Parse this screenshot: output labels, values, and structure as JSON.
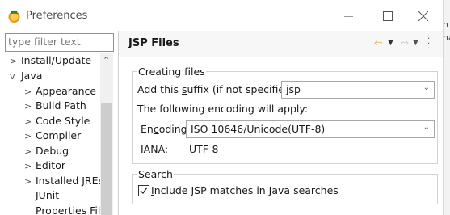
{
  "window": {
    "title": "Preferences"
  },
  "filter": {
    "placeholder": "type filter text"
  },
  "tree": {
    "items": [
      {
        "label": "Install/Update",
        "arrow": ">"
      },
      {
        "label": "Java",
        "arrow": "v"
      },
      {
        "label": "Appearance",
        "arrow": ">"
      },
      {
        "label": "Build Path",
        "arrow": ">"
      },
      {
        "label": "Code Style",
        "arrow": ">"
      },
      {
        "label": "Compiler",
        "arrow": ">"
      },
      {
        "label": "Debug",
        "arrow": ">"
      },
      {
        "label": "Editor",
        "arrow": ">"
      },
      {
        "label": "Installed JREs",
        "arrow": ">"
      },
      {
        "label": "JUnit",
        "arrow": ""
      },
      {
        "label": "Properties Files",
        "arrow": ""
      }
    ]
  },
  "pane": {
    "title": "JSP Files",
    "creating_group": {
      "label": "Creating files",
      "suffix_label_pre": "Add this ",
      "suffix_label_mnemonic": "s",
      "suffix_label_post": "uffix (if not specified):",
      "suffix_value": "jsp",
      "encoding_note": "The following encoding will apply:",
      "encoding_label_pre": "En",
      "encoding_label_mnemonic": "c",
      "encoding_label_post": "oding:",
      "encoding_value": "ISO 10646/Unicode(UTF-8)",
      "iana_label": "IANA:",
      "iana_value": "UTF-8"
    },
    "search_group": {
      "label": "Search",
      "checkbox_mnemonic": "I",
      "checkbox_label_post": "nclude JSP matches in Java searches",
      "checked": true
    }
  },
  "background_window": {
    "fragments": [
      "h",
      "na"
    ]
  },
  "colors": {
    "nav_back": "#d89b12",
    "header_bg": "#f7f7f7"
  }
}
